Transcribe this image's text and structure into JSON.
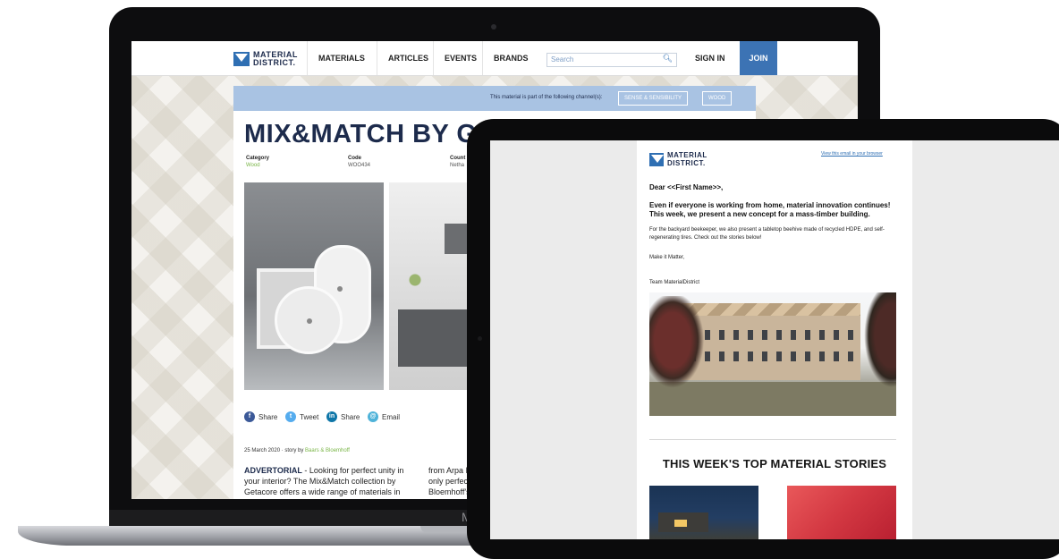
{
  "laptop": {
    "chin_label": "M",
    "site": {
      "logo_line1": "MATERIAL",
      "logo_line2": "DISTRICT.",
      "nav": [
        "MATERIALS",
        "ARTICLES",
        "EVENTS",
        "BRANDS"
      ],
      "search_placeholder": "Search",
      "sign_in": "SIGN IN",
      "join": "JOIN",
      "channel_text": "This material is part of the following channel(s):",
      "channel_tags": [
        "SENSE & SENSIBILITY",
        "WOOD"
      ],
      "title": "MIX&MATCH BY GETAC",
      "meta": [
        {
          "label": "Category",
          "value": "Wood"
        },
        {
          "label": "Code",
          "value": "WOO434"
        },
        {
          "label": "Count",
          "value": "Netha"
        }
      ],
      "share": [
        {
          "glyph": "f",
          "label": "Share",
          "color": "#3b5998"
        },
        {
          "glyph": "t",
          "label": "Tweet",
          "color": "#55acee"
        },
        {
          "glyph": "in",
          "label": "Share",
          "color": "#0e76a8"
        },
        {
          "glyph": "@",
          "label": "Email",
          "color": "#4fb3d9"
        }
      ],
      "article_date": "25 March 2020 · story by ",
      "article_author": "Baars & Bloemhoff",
      "article_lead": "ADVERTORIAL",
      "article_col1": " - Looking for perfect unity in your interior? The Mix&Match collection by Getacore offers a wide range of materials in",
      "article_col2": "from Arpa Indu only perfect co Bloemhoff's Di"
    }
  },
  "tablet": {
    "email": {
      "logo_line1": "MATERIAL",
      "logo_line2": "DISTRICT.",
      "view_link": "View this email in your browser",
      "greeting": "Dear <<First Name>>,",
      "intro": "Even if everyone is working from home, material innovation continues! This week, we present a new concept for a mass-timber building.",
      "body": "For the backyard beekeeper, we also present a tabletop beehive made of recycled HDPE, and self-regenerating tires. Check out the stories below!",
      "sign_1": "Make it Matter,",
      "sign_2": "Team MaterialDistrict",
      "section_title": "THIS WEEK'S TOP MATERIAL STORIES"
    }
  }
}
